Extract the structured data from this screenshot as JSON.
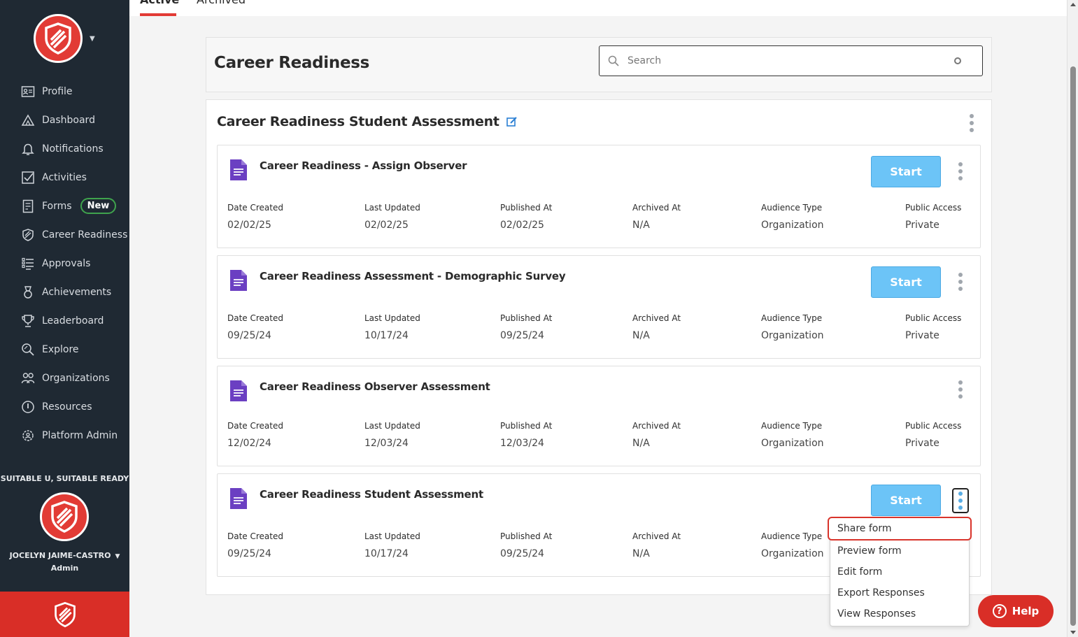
{
  "colors": {
    "sidebar_bg": "#1f2933",
    "brand_red": "#e23b35",
    "start_blue": "#6cc4f7",
    "form_icon_purple": "#6b3fc2",
    "new_badge_green": "#3fa34d"
  },
  "tabs": {
    "active": "Active",
    "archived": "Archived"
  },
  "sidebar": {
    "items": [
      {
        "label": "Profile",
        "icon": "profile-card-icon"
      },
      {
        "label": "Dashboard",
        "icon": "dashboard-icon"
      },
      {
        "label": "Notifications",
        "icon": "bell-icon"
      },
      {
        "label": "Activities",
        "icon": "checkbox-icon"
      },
      {
        "label": "Forms",
        "icon": "form-icon",
        "badge": "New"
      },
      {
        "label": "Career Readiness",
        "icon": "shield-icon"
      },
      {
        "label": "Approvals",
        "icon": "list-check-icon"
      },
      {
        "label": "Achievements",
        "icon": "medal-icon"
      },
      {
        "label": "Leaderboard",
        "icon": "trophy-icon"
      },
      {
        "label": "Explore",
        "icon": "explore-search-icon"
      },
      {
        "label": "Organizations",
        "icon": "people-icon"
      },
      {
        "label": "Resources",
        "icon": "info-circle-icon"
      },
      {
        "label": "Platform Admin",
        "icon": "admin-gear-icon"
      }
    ],
    "org_name": "SUITABLE U, SUITABLE READY",
    "user_name": "JOCELYN JAIME-CASTRO",
    "user_role": "Admin"
  },
  "header": {
    "title": "Career Readiness",
    "search_placeholder": "Search"
  },
  "group": {
    "title": "Career Readiness Student Assessment"
  },
  "meta_labels": {
    "date_created": "Date Created",
    "last_updated": "Last Updated",
    "published_at": "Published At",
    "archived_at": "Archived At",
    "audience_type": "Audience Type",
    "public_access": "Public Access"
  },
  "forms": [
    {
      "title": "Career Readiness - Assign Observer",
      "start": "Start",
      "date_created": "02/02/25",
      "last_updated": "02/02/25",
      "published_at": "02/02/25",
      "archived_at": "N/A",
      "audience_type": "Organization",
      "public_access": "Private"
    },
    {
      "title": "Career Readiness Assessment - Demographic Survey",
      "start": "Start",
      "date_created": "09/25/24",
      "last_updated": "10/17/24",
      "published_at": "09/25/24",
      "archived_at": "N/A",
      "audience_type": "Organization",
      "public_access": "Private"
    },
    {
      "title": "Career Readiness Observer Assessment",
      "start": "",
      "date_created": "12/02/24",
      "last_updated": "12/03/24",
      "published_at": "12/03/24",
      "archived_at": "N/A",
      "audience_type": "Organization",
      "public_access": "Private"
    },
    {
      "title": "Career Readiness Student Assessment",
      "start": "Start",
      "date_created": "09/25/24",
      "last_updated": "10/17/24",
      "published_at": "09/25/24",
      "archived_at": "N/A",
      "audience_type": "Organization",
      "public_access": ""
    }
  ],
  "dropdown": {
    "items": [
      "Share form",
      "Preview form",
      "Edit form",
      "Export Responses",
      "View Responses"
    ]
  },
  "help": {
    "label": "Help"
  }
}
